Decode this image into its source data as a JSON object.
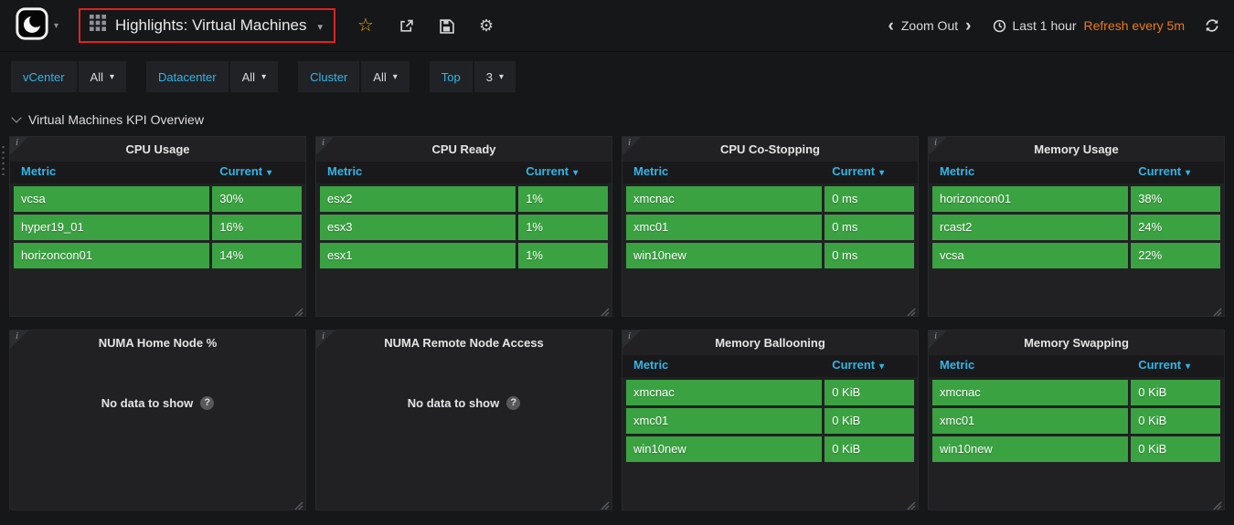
{
  "colors": {
    "green": "#3aa241",
    "blue": "#33b5e5",
    "orange": "#eb7b18",
    "red": "#e02222"
  },
  "icons": {
    "star": "☆",
    "gear": "⚙",
    "caret_down": "▾",
    "chevron_left": "‹",
    "chevron_right": "›",
    "info": "i",
    "question": "?"
  },
  "navbar": {
    "title": "Highlights: Virtual Machines",
    "zoom_out_label": "Zoom Out",
    "time_range_label": "Last 1 hour",
    "refresh_label": "Refresh every 5m"
  },
  "filters": [
    {
      "label": "vCenter",
      "value": "All"
    },
    {
      "label": "Datacenter",
      "value": "All"
    },
    {
      "label": "Cluster",
      "value": "All"
    },
    {
      "label": "Top",
      "value": "3"
    }
  ],
  "row_section": {
    "title": "Virtual Machines KPI Overview"
  },
  "table_columns": {
    "metric": "Metric",
    "current": "Current"
  },
  "no_data_label": "No data to show",
  "panels": [
    {
      "title": "CPU Usage",
      "rows": [
        [
          "vcsa",
          "30%"
        ],
        [
          "hyper19_01",
          "16%"
        ],
        [
          "horizoncon01",
          "14%"
        ]
      ]
    },
    {
      "title": "CPU Ready",
      "rows": [
        [
          "esx2",
          "1%"
        ],
        [
          "esx3",
          "1%"
        ],
        [
          "esx1",
          "1%"
        ]
      ]
    },
    {
      "title": "CPU Co-Stopping",
      "rows": [
        [
          "xmcnac",
          "0 ms"
        ],
        [
          "xmc01",
          "0 ms"
        ],
        [
          "win10new",
          "0 ms"
        ]
      ]
    },
    {
      "title": "Memory Usage",
      "rows": [
        [
          "horizoncon01",
          "38%"
        ],
        [
          "rcast2",
          "24%"
        ],
        [
          "vcsa",
          "22%"
        ]
      ]
    },
    {
      "title": "NUMA Home Node %",
      "no_data": true
    },
    {
      "title": "NUMA Remote Node Access",
      "no_data": true
    },
    {
      "title": "Memory Ballooning",
      "rows": [
        [
          "xmcnac",
          "0 KiB"
        ],
        [
          "xmc01",
          "0 KiB"
        ],
        [
          "win10new",
          "0 KiB"
        ]
      ]
    },
    {
      "title": "Memory Swapping",
      "rows": [
        [
          "xmcnac",
          "0 KiB"
        ],
        [
          "xmc01",
          "0 KiB"
        ],
        [
          "win10new",
          "0 KiB"
        ]
      ]
    }
  ]
}
